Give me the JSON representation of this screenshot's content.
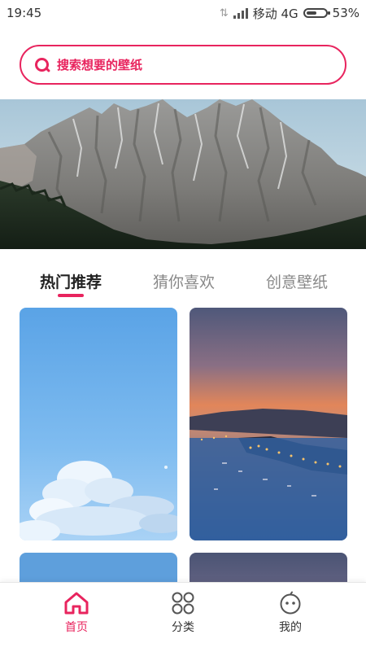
{
  "status_bar": {
    "time": "19:45",
    "carrier": "移动 4G",
    "battery_percent": "53%",
    "battery_level": 0.53
  },
  "search": {
    "placeholder": "搜索想要的壁纸"
  },
  "banner": {
    "image": "dolomite-mountains-photo"
  },
  "tabs": [
    {
      "label": "热门推荐",
      "active": true
    },
    {
      "label": "猜你喜欢",
      "active": false
    },
    {
      "label": "创意壁纸",
      "active": false
    }
  ],
  "wallpapers": [
    {
      "image": "blue-sky-clouds"
    },
    {
      "image": "coastal-town-sunset"
    },
    {
      "image": "blue-gradient"
    },
    {
      "image": "dusk-gradient"
    }
  ],
  "bottom_nav": [
    {
      "label": "首页",
      "icon": "home-icon",
      "active": true
    },
    {
      "label": "分类",
      "icon": "grid-icon",
      "active": false
    },
    {
      "label": "我的",
      "icon": "face-icon",
      "active": false
    }
  ],
  "colors": {
    "accent": "#e8245e"
  }
}
